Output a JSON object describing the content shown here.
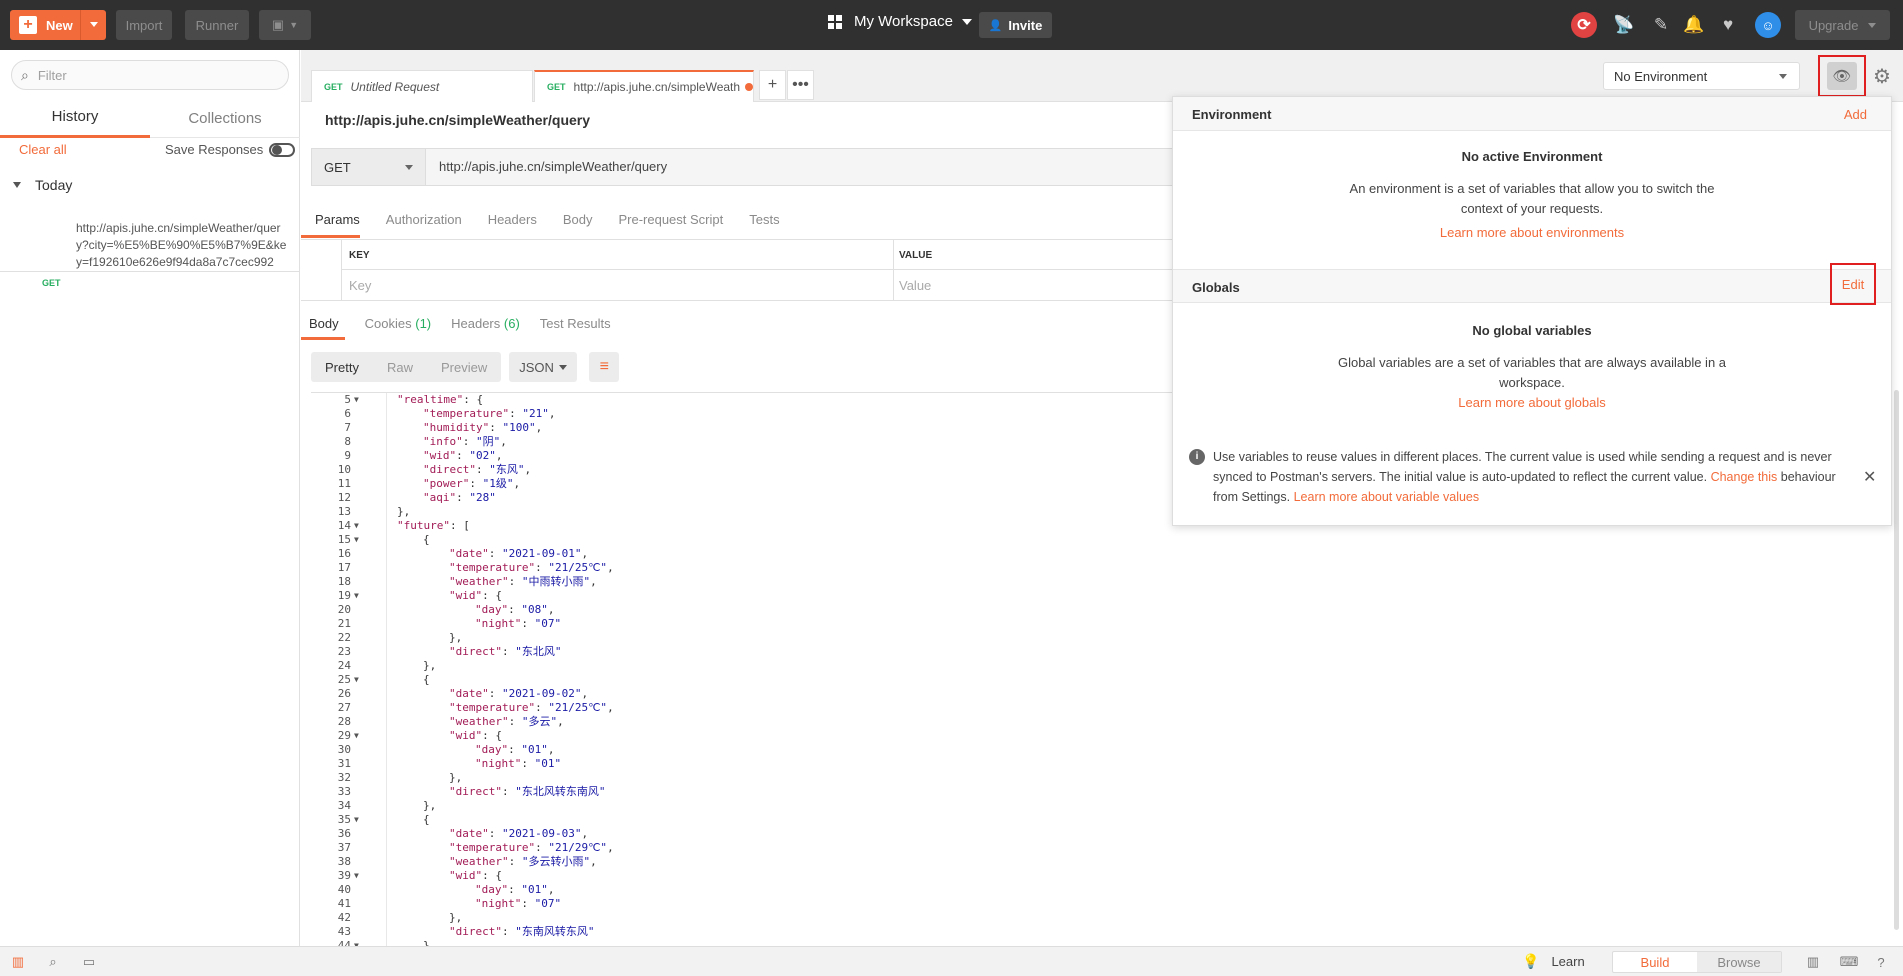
{
  "topbar": {
    "new_label": "New",
    "import_label": "Import",
    "runner_label": "Runner",
    "workspace_label": "My Workspace",
    "invite_label": "Invite",
    "upgrade_label": "Upgrade"
  },
  "sidebar": {
    "filter_placeholder": "Filter",
    "tabs": [
      {
        "label": "History"
      },
      {
        "label": "Collections"
      }
    ],
    "clear_all": "Clear all",
    "save_responses": "Save Responses",
    "group_label": "Today",
    "items": [
      {
        "method": "GET",
        "url": "http://apis.juhe.cn/simpleWeather/query?city=%E5%BE%90%E5%B7%9E&key=f192610e626e9f94da8a7c7cec992"
      }
    ]
  },
  "tabs": [
    {
      "method": "GET",
      "label": "Untitled Request"
    },
    {
      "method": "GET",
      "label": "http://apis.juhe.cn/simpleWeath"
    }
  ],
  "environment": {
    "selected": "No Environment"
  },
  "request": {
    "title": "http://apis.juhe.cn/simpleWeather/query",
    "method": "GET",
    "url": "http://apis.juhe.cn/simpleWeather/query",
    "subtabs": [
      "Params",
      "Authorization",
      "Headers",
      "Body",
      "Pre-request Script",
      "Tests"
    ],
    "params_header_key": "KEY",
    "params_header_value": "VALUE",
    "key_placeholder": "Key",
    "value_placeholder": "Value"
  },
  "response": {
    "tabs": {
      "body": "Body",
      "cookies": "Cookies",
      "cookies_count": "(1)",
      "headers": "Headers",
      "headers_count": "(6)",
      "test_results": "Test Results"
    },
    "views": [
      "Pretty",
      "Raw",
      "Preview"
    ],
    "format": "JSON",
    "lines": [
      {
        "n": "5",
        "fold": true,
        "indent": 2,
        "k": "realtime",
        "v": null,
        "tail": ": {"
      },
      {
        "n": "6",
        "indent": 3,
        "k": "temperature",
        "v": "21",
        "tail": ","
      },
      {
        "n": "7",
        "indent": 3,
        "k": "humidity",
        "v": "100",
        "tail": ","
      },
      {
        "n": "8",
        "indent": 3,
        "k": "info",
        "v": "阴",
        "tail": ","
      },
      {
        "n": "9",
        "indent": 3,
        "k": "wid",
        "v": "02",
        "tail": ","
      },
      {
        "n": "10",
        "indent": 3,
        "k": "direct",
        "v": "东风",
        "tail": ","
      },
      {
        "n": "11",
        "indent": 3,
        "k": "power",
        "v": "1级",
        "tail": ","
      },
      {
        "n": "12",
        "indent": 3,
        "k": "aqi",
        "v": "28",
        "tail": ""
      },
      {
        "n": "13",
        "indent": 2,
        "raw": "},"
      },
      {
        "n": "14",
        "fold": true,
        "indent": 2,
        "k": "future",
        "v": null,
        "tail": ": ["
      },
      {
        "n": "15",
        "fold": true,
        "indent": 3,
        "raw": "{"
      },
      {
        "n": "16",
        "indent": 4,
        "k": "date",
        "v": "2021-09-01",
        "tail": ","
      },
      {
        "n": "17",
        "indent": 4,
        "k": "temperature",
        "v": "21/25℃",
        "tail": ","
      },
      {
        "n": "18",
        "indent": 4,
        "k": "weather",
        "v": "中雨转小雨",
        "tail": ","
      },
      {
        "n": "19",
        "fold": true,
        "indent": 4,
        "k": "wid",
        "v": null,
        "tail": ": {"
      },
      {
        "n": "20",
        "indent": 5,
        "k": "day",
        "v": "08",
        "tail": ","
      },
      {
        "n": "21",
        "indent": 5,
        "k": "night",
        "v": "07",
        "tail": ""
      },
      {
        "n": "22",
        "indent": 4,
        "raw": "},"
      },
      {
        "n": "23",
        "indent": 4,
        "k": "direct",
        "v": "东北风",
        "tail": ""
      },
      {
        "n": "24",
        "indent": 3,
        "raw": "},"
      },
      {
        "n": "25",
        "fold": true,
        "indent": 3,
        "raw": "{"
      },
      {
        "n": "26",
        "indent": 4,
        "k": "date",
        "v": "2021-09-02",
        "tail": ","
      },
      {
        "n": "27",
        "indent": 4,
        "k": "temperature",
        "v": "21/25℃",
        "tail": ","
      },
      {
        "n": "28",
        "indent": 4,
        "k": "weather",
        "v": "多云",
        "tail": ","
      },
      {
        "n": "29",
        "fold": true,
        "indent": 4,
        "k": "wid",
        "v": null,
        "tail": ": {"
      },
      {
        "n": "30",
        "indent": 5,
        "k": "day",
        "v": "01",
        "tail": ","
      },
      {
        "n": "31",
        "indent": 5,
        "k": "night",
        "v": "01",
        "tail": ""
      },
      {
        "n": "32",
        "indent": 4,
        "raw": "},"
      },
      {
        "n": "33",
        "indent": 4,
        "k": "direct",
        "v": "东北风转东南风",
        "tail": ""
      },
      {
        "n": "34",
        "indent": 3,
        "raw": "},"
      },
      {
        "n": "35",
        "fold": true,
        "indent": 3,
        "raw": "{"
      },
      {
        "n": "36",
        "indent": 4,
        "k": "date",
        "v": "2021-09-03",
        "tail": ","
      },
      {
        "n": "37",
        "indent": 4,
        "k": "temperature",
        "v": "21/29℃",
        "tail": ","
      },
      {
        "n": "38",
        "indent": 4,
        "k": "weather",
        "v": "多云转小雨",
        "tail": ","
      },
      {
        "n": "39",
        "fold": true,
        "indent": 4,
        "k": "wid",
        "v": null,
        "tail": ": {"
      },
      {
        "n": "40",
        "indent": 5,
        "k": "day",
        "v": "01",
        "tail": ","
      },
      {
        "n": "41",
        "indent": 5,
        "k": "night",
        "v": "07",
        "tail": ""
      },
      {
        "n": "42",
        "indent": 4,
        "raw": "},"
      },
      {
        "n": "43",
        "indent": 4,
        "k": "direct",
        "v": "东南风转东风",
        "tail": ""
      },
      {
        "n": "44",
        "fold": true,
        "indent": 3,
        "raw": "},"
      }
    ]
  },
  "popover": {
    "env_header": "Environment",
    "env_add": "Add",
    "env_title": "No active Environment",
    "env_desc_1": "An environment is a set of variables that allow you to switch the",
    "env_desc_2": "context of your requests.",
    "env_link": "Learn more about environments",
    "globals_header": "Globals",
    "globals_edit": "Edit",
    "globals_title": "No global variables",
    "globals_desc_1": "Global variables are a set of variables that are always available in a",
    "globals_desc_2": "workspace.",
    "globals_link": "Learn more about globals",
    "info_1": "Use variables to reuse values in different places. The current value is used while sending a request and is never",
    "info_2": "synced to Postman's servers. The initial value is auto-updated to reflect the current value.",
    "info_change": "Change this",
    "info_3": "behaviour",
    "info_4": "from Settings.",
    "info_link": "Learn more about variable values"
  },
  "bottombar": {
    "learn": "Learn",
    "build": "Build",
    "browse": "Browse"
  },
  "colors": {
    "accent": "#f26b3a",
    "get_method": "#27ae60",
    "highlight_box": "#e02020"
  }
}
